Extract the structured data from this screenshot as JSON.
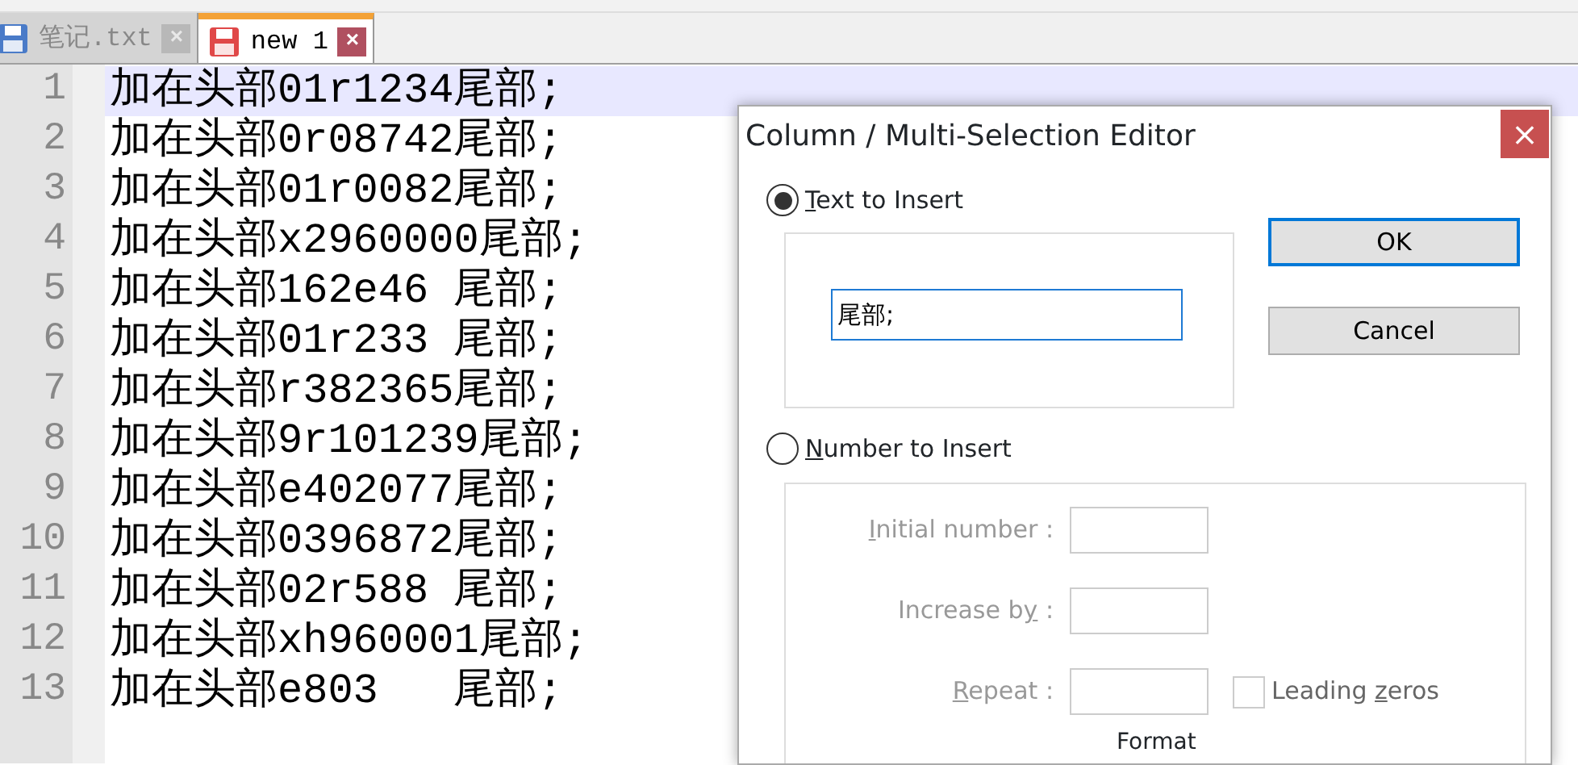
{
  "tabs": [
    {
      "label": "笔记.txt",
      "selected": false,
      "modified": false,
      "close": "×"
    },
    {
      "label": "new 1",
      "selected": true,
      "modified": true,
      "close": "×"
    }
  ],
  "editor": {
    "lines": [
      {
        "number": "1",
        "text": "加在头部01r1234尾部;",
        "current": true
      },
      {
        "number": "2",
        "text": "加在头部0r08742尾部;",
        "current": false
      },
      {
        "number": "3",
        "text": "加在头部01r0082尾部;",
        "current": false
      },
      {
        "number": "4",
        "text": "加在头部x2960000尾部;",
        "current": false
      },
      {
        "number": "5",
        "text": "加在头部162e46 尾部;",
        "current": false
      },
      {
        "number": "6",
        "text": "加在头部01r233 尾部;",
        "current": false
      },
      {
        "number": "7",
        "text": "加在头部r382365尾部;",
        "current": false
      },
      {
        "number": "8",
        "text": "加在头部9r101239尾部;",
        "current": false
      },
      {
        "number": "9",
        "text": "加在头部e402077尾部;",
        "current": false
      },
      {
        "number": "10",
        "text": "加在头部0396872尾部;",
        "current": false
      },
      {
        "number": "11",
        "text": "加在头部02r588 尾部;",
        "current": false
      },
      {
        "number": "12",
        "text": "加在头部xh960001尾部;",
        "current": false
      },
      {
        "number": "13",
        "text": "加在头部e803   尾部;",
        "current": false
      }
    ]
  },
  "dialog": {
    "title": "Column / Multi-Selection Editor",
    "close": "×",
    "text_option": {
      "label": [
        {
          "text": "T",
          "underlined": true
        },
        {
          "text": "ext to Insert",
          "underlined": false
        }
      ],
      "selected": true,
      "value": "尾部;"
    },
    "number_option": {
      "label": [
        {
          "text": "N",
          "underlined": true
        },
        {
          "text": "umber to Insert",
          "underlined": false
        }
      ],
      "selected": false,
      "disabled": true,
      "fields": [
        {
          "label": [
            {
              "text": "I",
              "underlined": true
            },
            {
              "text": "nitial number :",
              "underlined": false
            }
          ]
        },
        {
          "label": [
            {
              "text": "Increase b",
              "underlined": false
            },
            {
              "text": "y",
              "underlined": true
            },
            {
              "text": " :",
              "underlined": false
            }
          ]
        },
        {
          "label": [
            {
              "text": "R",
              "underlined": true
            },
            {
              "text": "epeat :",
              "underlined": false
            }
          ]
        }
      ],
      "leading_zeros": {
        "label": [
          {
            "text": "Leading ",
            "underlined": false
          },
          {
            "text": "z",
            "underlined": true
          },
          {
            "text": "eros",
            "underlined": false
          }
        ],
        "checked": false
      },
      "format_label": "Format"
    },
    "buttons": [
      {
        "label": "OK",
        "default": true
      },
      {
        "label": "Cancel",
        "default": false
      }
    ]
  }
}
